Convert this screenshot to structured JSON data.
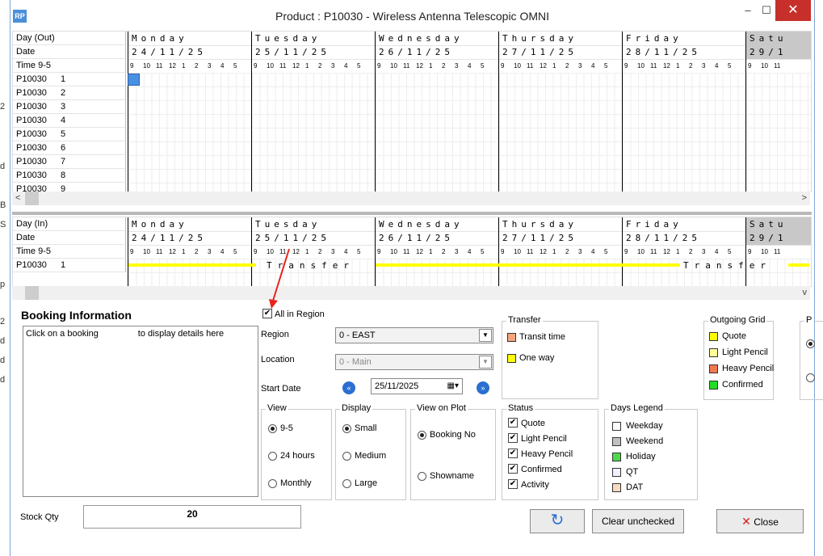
{
  "window": {
    "title": "Product : P10030 - Wireless Antenna Telescopic OMNI",
    "icon_text": "RP",
    "minimize": "–",
    "maximize": "☐",
    "close": "✕"
  },
  "left_clip": [
    "2",
    "d",
    "B",
    "S",
    "p",
    "2",
    "d",
    "d",
    "d"
  ],
  "days": [
    {
      "name": "Monday",
      "date": "24/11/25"
    },
    {
      "name": "Tuesday",
      "date": "25/11/25"
    },
    {
      "name": "Wednesday",
      "date": "26/11/25"
    },
    {
      "name": "Thursday",
      "date": "27/11/25"
    },
    {
      "name": "Friday",
      "date": "28/11/25"
    },
    {
      "name": "Satu",
      "date": "29/1"
    }
  ],
  "hours": [
    "9",
    "10",
    "11",
    "12",
    "1",
    "2",
    "3",
    "4",
    "5"
  ],
  "hours_partial": [
    "9",
    "10",
    "11"
  ],
  "out_grid": {
    "header_labels": [
      "Day (Out)",
      "Date",
      "Time 9-5"
    ],
    "rows": [
      {
        "code": "P10030",
        "num": "1"
      },
      {
        "code": "P10030",
        "num": "2"
      },
      {
        "code": "P10030",
        "num": "3"
      },
      {
        "code": "P10030",
        "num": "4"
      },
      {
        "code": "P10030",
        "num": "5"
      },
      {
        "code": "P10030",
        "num": "6"
      },
      {
        "code": "P10030",
        "num": "7"
      },
      {
        "code": "P10030",
        "num": "8"
      },
      {
        "code": "P10030",
        "num": "9"
      }
    ]
  },
  "in_grid": {
    "header_labels": [
      "Day (In)",
      "Date",
      "Time 9-5"
    ],
    "rows": [
      {
        "code": "P10030",
        "num": "1"
      }
    ],
    "transfer_text": "Transfer"
  },
  "booking": {
    "title": "Booking Information",
    "placeholder": "Click on a booking                to display details here"
  },
  "all_in_region": {
    "label": "All in Region",
    "checked": true
  },
  "region": {
    "label": "Region",
    "value": "0 - EAST"
  },
  "location": {
    "label": "Location",
    "value": "0 - Main"
  },
  "start_date": {
    "label": "Start Date",
    "value": "25/11/2025"
  },
  "view": {
    "title": "View",
    "options": [
      "9-5",
      "24 hours",
      "Monthly"
    ],
    "selected": 0
  },
  "display": {
    "title": "Display",
    "options": [
      "Small",
      "Medium",
      "Large"
    ],
    "selected": 0
  },
  "view_on_plot": {
    "title": "View on Plot",
    "options": [
      "Booking No",
      "Showname"
    ],
    "selected": 0
  },
  "transfer": {
    "title": "Transfer",
    "items": [
      {
        "label": "Transit time",
        "color": "#f4a67a"
      },
      {
        "label": "One way",
        "color": "#ffff00"
      }
    ]
  },
  "status": {
    "title": "Status",
    "items": [
      "Quote",
      "Light Pencil",
      "Heavy Pencil",
      "Confirmed",
      "Activity"
    ]
  },
  "days_legend": {
    "title": "Days Legend",
    "items": [
      {
        "label": "Weekday",
        "color": "#ffffff"
      },
      {
        "label": "Weekend",
        "color": "#c0c0c0"
      },
      {
        "label": "Holiday",
        "color": "#4cd94c"
      },
      {
        "label": "QT",
        "color": "#f0f0ff"
      },
      {
        "label": "DAT",
        "color": "#f7dcc0"
      }
    ]
  },
  "outgoing_grid": {
    "title": "Outgoing Grid",
    "items": [
      {
        "label": "Quote",
        "color": "#ffff00"
      },
      {
        "label": "Light Pencil",
        "color": "#ffff99"
      },
      {
        "label": "Heavy Pencil",
        "color": "#f07850"
      },
      {
        "label": "Confirmed",
        "color": "#22dd22"
      }
    ]
  },
  "clipped_group": {
    "title": "P"
  },
  "stock": {
    "label": "Stock Qty",
    "value": "20"
  },
  "buttons": {
    "refresh_icon": "↻",
    "clear": "Clear unchecked",
    "close": "Close",
    "close_icon": "✕"
  },
  "colors": {
    "selected_cell": "#4a90e2",
    "transfer_bar": "#ffff00",
    "weekend_header": "#c8c8c8"
  }
}
